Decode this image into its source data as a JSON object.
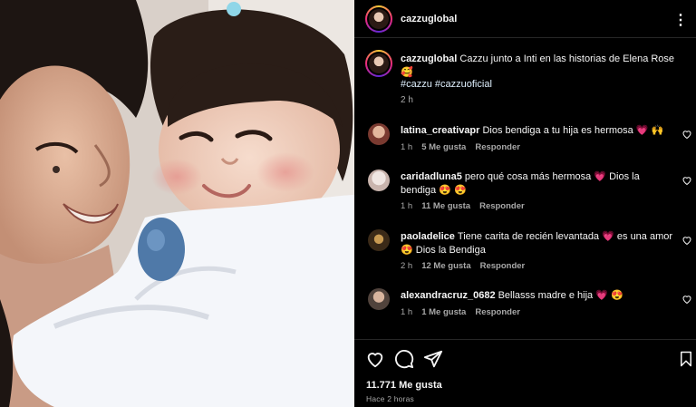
{
  "post": {
    "author": "cazzuglobal",
    "caption_user": "cazzuglobal",
    "caption_text": "Cazzu junto a Inti en las historias de Elena Rose",
    "caption_emoji": "🥰",
    "hashtags": "#cazzu #cazzuoficial",
    "caption_time": "2 h",
    "likes": "11.771 Me gusta",
    "posted_ago": "Hace 2 horas",
    "more_icon": "more-horizontal-icon"
  },
  "comments": [
    {
      "user": "latina_creativapr",
      "text": "Dios bendiga a tu hija es hermosa",
      "emoji": "💗 🙌",
      "time": "1 h",
      "likes": "5 Me gusta",
      "reply": "Responder"
    },
    {
      "user": "caridadluna5",
      "text": "pero qué cosa más hermosa",
      "emoji_mid": "💗",
      "text2": "Dios la bendiga",
      "emoji": "😍 😍",
      "time": "1 h",
      "likes": "11 Me gusta",
      "reply": "Responder"
    },
    {
      "user": "paoladelice",
      "text": "Tiene carita de recién levantada",
      "emoji_mid": "💗",
      "text2": "es una amor",
      "emoji_pre": "😍",
      "text3": "Dios la Bendiga",
      "time": "2 h",
      "likes": "12 Me gusta",
      "reply": "Responder"
    },
    {
      "user": "alexandracruz_0682",
      "text": "Bellasss madre e hija",
      "emoji": "💗 😍",
      "time": "1 h",
      "likes": "1 Me gusta",
      "reply": "Responder"
    }
  ],
  "colors": {
    "background": "#000000",
    "text": "#f5f5f5",
    "muted": "#a8a8a8",
    "divider": "#262626",
    "heart": "#ed4956",
    "hashtag": "#e0f1ff"
  },
  "icons": [
    "heart-icon",
    "comment-icon",
    "share-icon",
    "bookmark-icon",
    "more-horizontal-icon"
  ]
}
